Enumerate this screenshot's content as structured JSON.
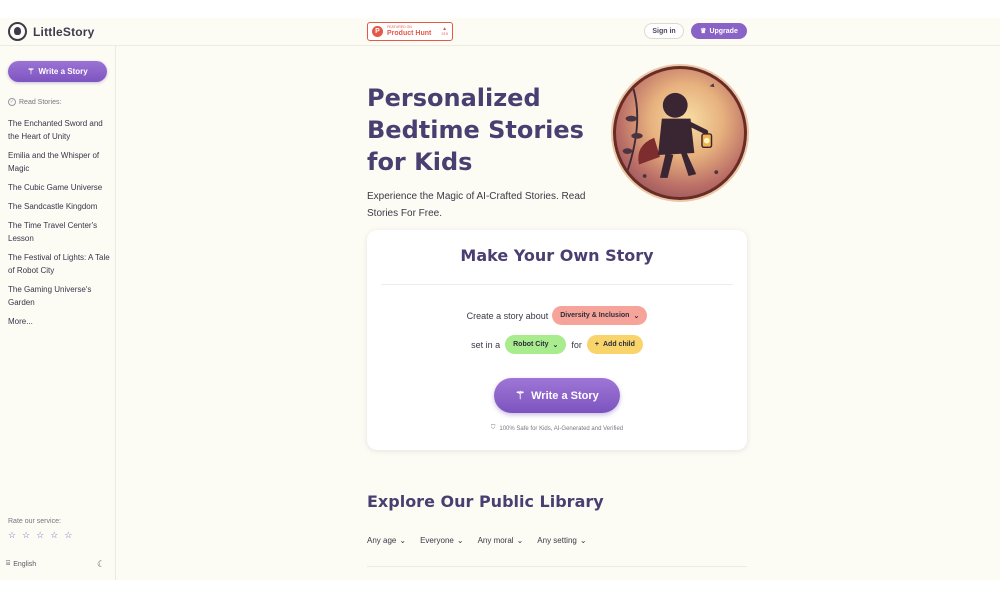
{
  "header": {
    "logo_text": "LittleStory",
    "product_hunt": {
      "small_label": "Featured on",
      "name": "Product Hunt",
      "votes": "219"
    },
    "signin_label": "Sign in",
    "upgrade_label": "Upgrade"
  },
  "sidebar": {
    "write_button": "Write a Story",
    "read_label": "Read Stories:",
    "stories": [
      "The Enchanted Sword and the Heart of Unity",
      "Emilia and the Whisper of Magic",
      "The Cubic Game Universe",
      "The Sandcastle Kingdom",
      "The Time Travel Center's Lesson",
      "The Festival of Lights: A Tale of Robot City",
      "The Gaming Universe's Garden",
      "More..."
    ],
    "rate_label": "Rate our service:",
    "rating": 0,
    "rating_max": 5,
    "language": "English"
  },
  "hero": {
    "title": "Personalized Bedtime Stories for Kids",
    "subtitle": "Experience the Magic of AI-Crafted Stories. Read Stories For Free."
  },
  "card": {
    "title": "Make Your Own Story",
    "prefix1": "Create a story about",
    "theme": "Diversity & Inclusion",
    "prefix2": "set in a",
    "setting": "Robot City",
    "joiner": "for",
    "add_child": "Add child",
    "write_button": "Write a Story",
    "safe_text": "100% Safe for Kids, AI-Generated and Verified"
  },
  "library": {
    "title": "Explore Our Public Library",
    "filters": [
      "Any age",
      "Everyone",
      "Any moral",
      "Any setting"
    ]
  },
  "colors": {
    "accent": "#8a63c7",
    "heading": "#4a3f70",
    "background": "#fdfcf4",
    "theme_pill": "#f6a49a",
    "setting_pill": "#a8ec8d",
    "child_pill": "#f8d46b",
    "product_hunt": "#e3584a"
  },
  "icons": {
    "logo": "child-face-icon",
    "upgrade": "crown-icon",
    "write": "magic-wand-icon",
    "read": "check-circle-icon",
    "star": "star-icon",
    "language": "translate-icon",
    "theme_toggle": "moon-icon",
    "dropdown": "chevron-down-icon",
    "safe": "shield-icon",
    "add": "plus-icon"
  }
}
